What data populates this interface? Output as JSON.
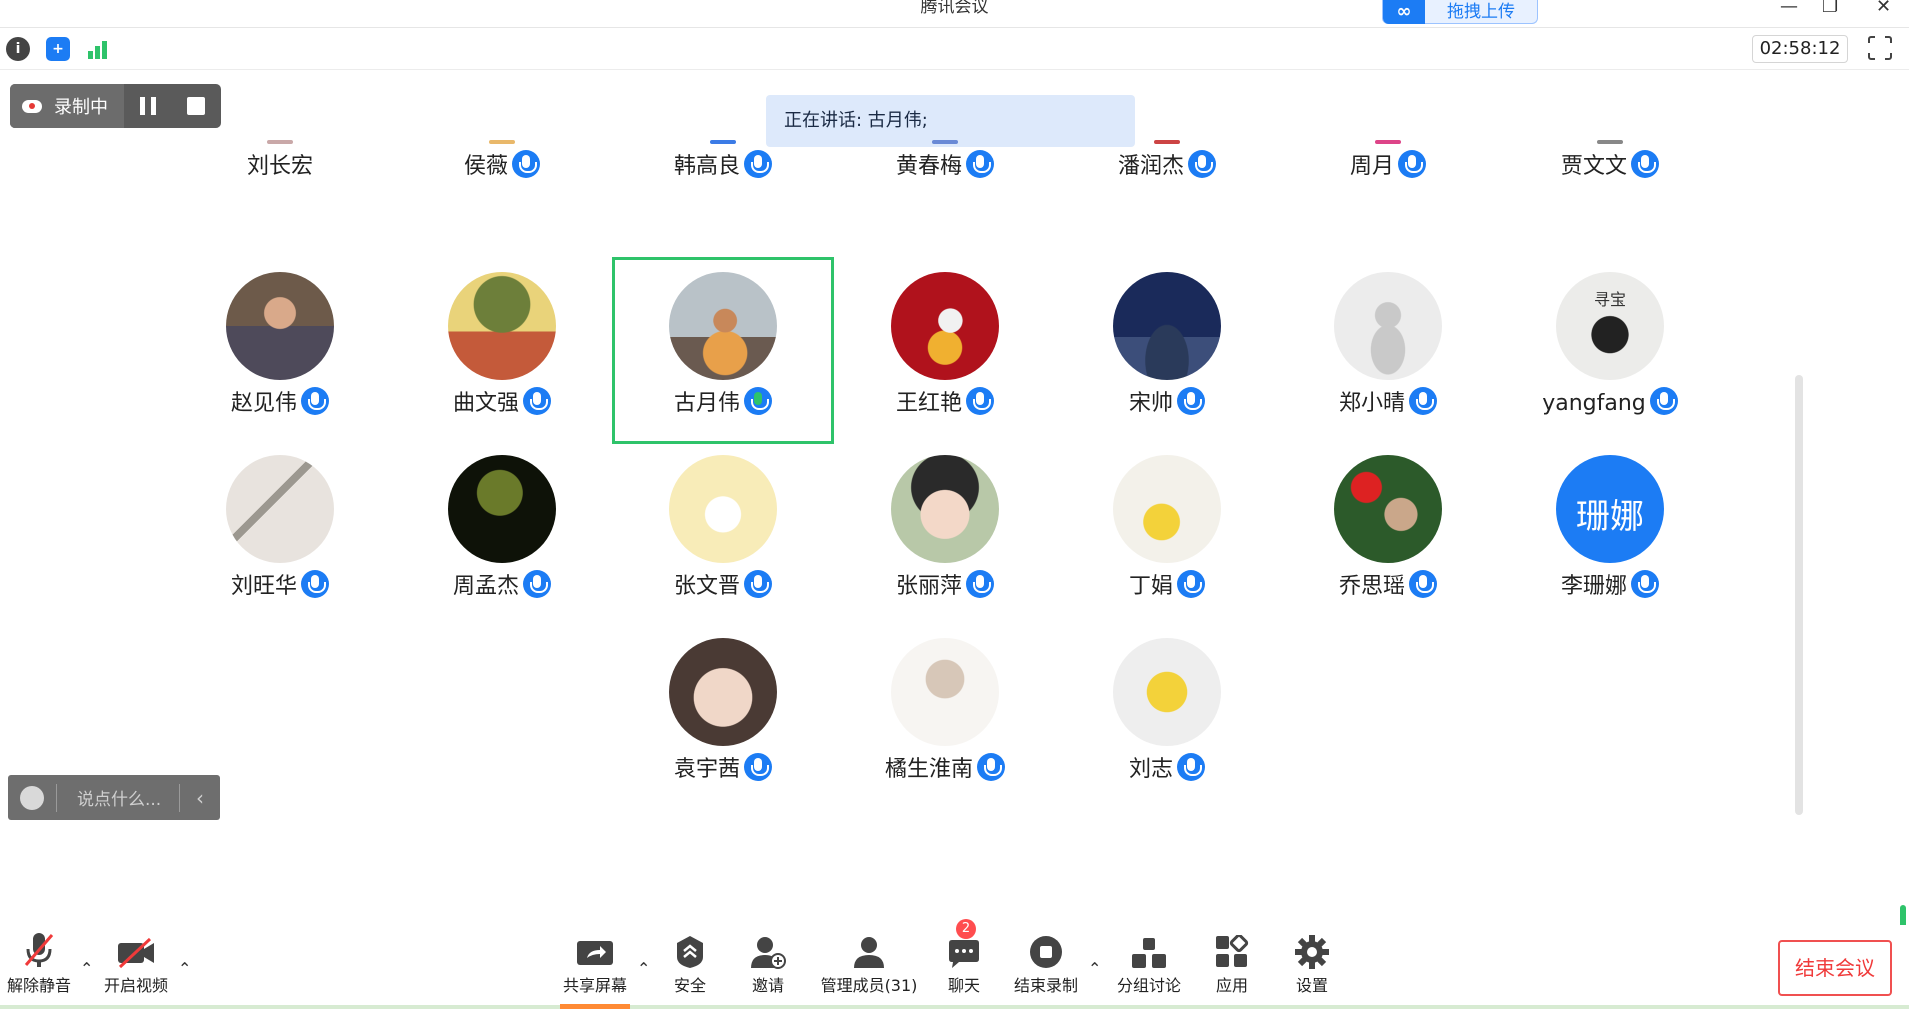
{
  "window": {
    "title": "腾讯会议",
    "upload_label": "拖拽上传"
  },
  "top": {
    "timer": "02:58:12"
  },
  "recording": {
    "label": "录制中"
  },
  "speaking": {
    "text": "正在讲话: 古月伟;"
  },
  "partial_row": [
    "刘长宏",
    "侯薇",
    "韩高良",
    "黄春梅",
    "潘润杰",
    "周月",
    "贾文文"
  ],
  "participants": [
    {
      "name": "赵见伟",
      "avatar": "photo-man"
    },
    {
      "name": "曲文强",
      "avatar": "tree-photo"
    },
    {
      "name": "古月伟",
      "avatar": "girl-photo",
      "speaking": true
    },
    {
      "name": "王红艳",
      "avatar": "red-illustration"
    },
    {
      "name": "宋帅",
      "avatar": "night-sky"
    },
    {
      "name": "郑小晴",
      "avatar": "default-user"
    },
    {
      "name": "yangfang",
      "avatar": "ink-drawing",
      "avatar_text": "寻宝"
    },
    {
      "name": "刘旺华",
      "avatar": "sketch-horse"
    },
    {
      "name": "周孟杰",
      "avatar": "dark-tree"
    },
    {
      "name": "张文晋",
      "avatar": "cartoon-cat"
    },
    {
      "name": "张丽萍",
      "avatar": "cartoon-child"
    },
    {
      "name": "丁娟",
      "avatar": "pikachu-flag"
    },
    {
      "name": "乔思瑶",
      "avatar": "roses-photo"
    },
    {
      "name": "李珊娜",
      "avatar": "text-avatar",
      "avatar_text": "珊娜"
    },
    {
      "name": "袁宇茜",
      "avatar": "baby-photo"
    },
    {
      "name": "橘生淮南",
      "avatar": "girl-sketch"
    },
    {
      "name": "刘志",
      "avatar": "pikachu"
    }
  ],
  "chat": {
    "placeholder": "说点什么..."
  },
  "toolbar": {
    "unmute": "解除静音",
    "start_video": "开启视频",
    "share": "共享屏幕",
    "security": "安全",
    "invite": "邀请",
    "members": "管理成员(31)",
    "chat": "聊天",
    "chat_badge": "2",
    "end_record": "结束录制",
    "breakout": "分组讨论",
    "apps": "应用",
    "settings": "设置",
    "end_meeting": "结束会议"
  },
  "colors": {
    "accent": "#1c7cf4",
    "speaking": "#2ec36a",
    "danger": "#f03a3a"
  }
}
